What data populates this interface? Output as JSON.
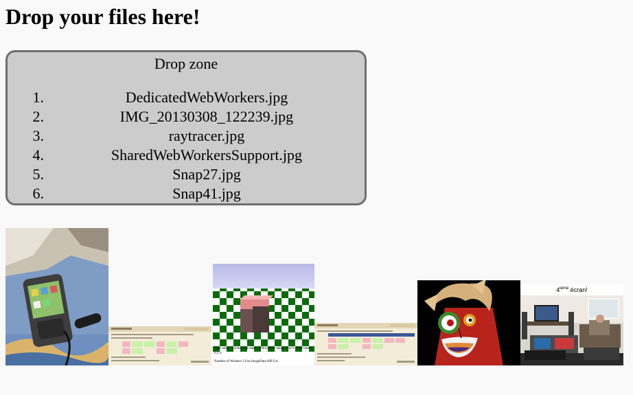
{
  "page": {
    "heading": "Drop your files here!"
  },
  "drop_zone": {
    "title": "Drop zone",
    "files": [
      {
        "num": "1.",
        "name": "DedicatedWebWorkers.jpg"
      },
      {
        "num": "2.",
        "name": "IMG_20130308_122239.jpg"
      },
      {
        "num": "3.",
        "name": "raytracer.jpg"
      },
      {
        "num": "4.",
        "name": "SharedWebWorkersSupport.jpg"
      },
      {
        "num": "5.",
        "name": "Snap27.jpg"
      },
      {
        "num": "6.",
        "name": "Snap41.jpg"
      }
    ]
  },
  "thumbnails": {
    "raytracer_time": "Time taken: 1.424s Time taken: 0.961s Time taken: 0.447s Time taken: 0.57s",
    "raytracer_footer": "Number of Workers 2  Use ImageData API  Go!",
    "living_room_caption_prefix": "4",
    "living_room_caption_sup": "ième",
    "living_room_caption_suffix": " écran!"
  }
}
